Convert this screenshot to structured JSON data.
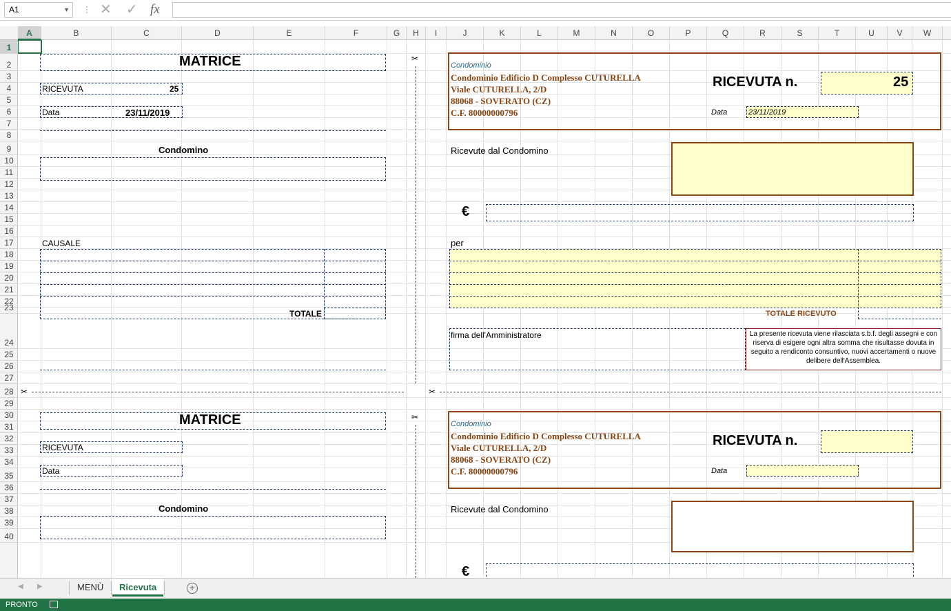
{
  "formula_bar": {
    "cell_ref": "A1",
    "formula": "",
    "fx_label": "fx"
  },
  "columns": [
    "A",
    "B",
    "C",
    "D",
    "E",
    "F",
    "G",
    "H",
    "I",
    "J",
    "K",
    "L",
    "M",
    "N",
    "O",
    "P",
    "Q",
    "R",
    "S",
    "T",
    "U",
    "V",
    "W"
  ],
  "rows": [
    "1",
    "2",
    "3",
    "4",
    "5",
    "6",
    "7",
    "8",
    "9",
    "10",
    "11",
    "12",
    "13",
    "14",
    "15",
    "16",
    "17",
    "18",
    "19",
    "20",
    "21",
    "22",
    "23",
    "24",
    "25",
    "26",
    "27",
    "28",
    "29",
    "30",
    "31",
    "32",
    "33",
    "34",
    "35",
    "36",
    "37",
    "38",
    "39",
    "40"
  ],
  "top": {
    "matrice_title": "MATRICE",
    "ricevuta_label": "RICEVUTA",
    "ricevuta_num": "25",
    "data_label": "Data",
    "data_value": "23/11/2019",
    "condomino_label": "Condomino",
    "causale_label": "CAUSALE",
    "totale_label": "TOTALE",
    "receipt": {
      "condominio_small": "Condominio",
      "name": "Condominio Edificio D Complesso CUTURELLA",
      "address": "Viale CUTURELLA, 2/D",
      "city": "88068 - SOVERATO (CZ)",
      "cf": "C.F.  80000000796",
      "ricevuta_title": "RICEVUTA n.",
      "ricevuta_num": "25",
      "data_label": "Data",
      "data_value": "23/11/2019",
      "ricevute_dal": "Ricevute dal Condomino",
      "euro": "€",
      "per": "per",
      "totale_ricevuto": "TOTALE RICEVUTO",
      "firma": "firma dell'Amministratore",
      "nota": "La presente ricevuta viene rilasciata s.b.f. degli assegni e con riserva di esigere ogni altra somma che risultasse dovuta in seguito a rendiconto consuntivo, nuovi accertamenti o nuove delibere dell'Assemblea."
    }
  },
  "bottom": {
    "matrice_title": "MATRICE",
    "ricevuta_label": "RICEVUTA",
    "data_label": "Data",
    "condomino_label": "Condomino",
    "receipt": {
      "condominio_small": "Condominio",
      "name": "Condominio Edificio D Complesso CUTURELLA",
      "address": "Viale CUTURELLA, 2/D",
      "city": "88068 - SOVERATO (CZ)",
      "cf": "C.F.  80000000796",
      "ricevuta_title": "RICEVUTA n.",
      "data_label": "Data",
      "ricevute_dal": "Ricevute dal Condomino",
      "euro": "€"
    }
  },
  "sheet_tabs": [
    "MENÙ",
    "Ricevuta"
  ],
  "active_tab": "Ricevuta",
  "status": "PRONTO",
  "colors": {
    "accent": "#217346",
    "brown": "#8b4513",
    "yellow": "#ffffcc"
  }
}
